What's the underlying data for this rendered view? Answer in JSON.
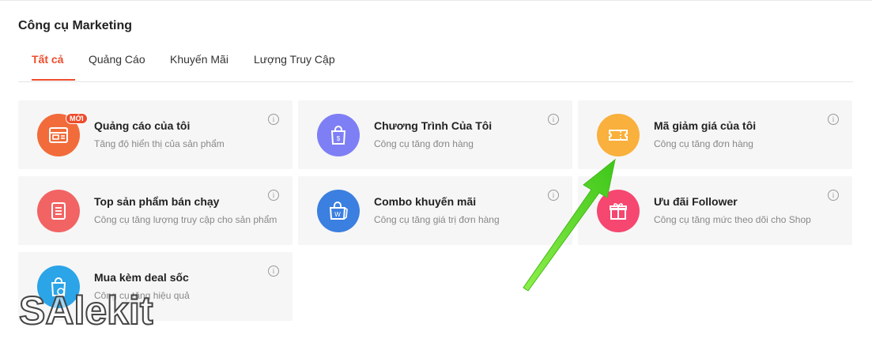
{
  "page": {
    "title": "Công cụ Marketing"
  },
  "tabs": [
    {
      "label": "Tất cả",
      "active": true
    },
    {
      "label": "Quảng Cáo"
    },
    {
      "label": "Khuyến Mãi"
    },
    {
      "label": "Lượng Truy Cập"
    }
  ],
  "cards": [
    {
      "title": "Quảng cáo của tôi",
      "desc": "Tăng độ hiển thị của sản phẩm",
      "icon": "ad-display-icon",
      "color": "#f26b3a",
      "badge": "MỚI"
    },
    {
      "title": "Chương Trình Của Tôi",
      "desc": "Công cụ tăng đơn hàng",
      "icon": "shopping-bag-icon",
      "color": "#7e7ff5"
    },
    {
      "title": "Mã giảm giá của tôi",
      "desc": "Công cụ tăng đơn hàng",
      "icon": "voucher-ticket-icon",
      "color": "#f9b03c"
    },
    {
      "title": "Top sản phẩm bán chạy",
      "desc": "Công cụ tăng lượng truy cập cho sản phẩm",
      "icon": "product-list-icon",
      "color": "#f26464"
    },
    {
      "title": "Combo khuyến mãi",
      "desc": "Công cụ tăng giá trị đơn hàng",
      "icon": "combo-bag-icon",
      "color": "#3b7fe0"
    },
    {
      "title": "Ưu đãi Follower",
      "desc": "Công cụ tăng mức theo dõi cho Shop",
      "icon": "gift-icon",
      "color": "#f5476f"
    },
    {
      "title": "Mua kèm deal sốc",
      "desc": "Công cụ tăng hiệu quả",
      "icon": "deal-bag-icon",
      "color": "#2ba4e8"
    }
  ],
  "info_glyph": "i",
  "watermark": {
    "text": "SAlekit"
  },
  "annotation": {
    "arrow_color": "#5fd625"
  }
}
